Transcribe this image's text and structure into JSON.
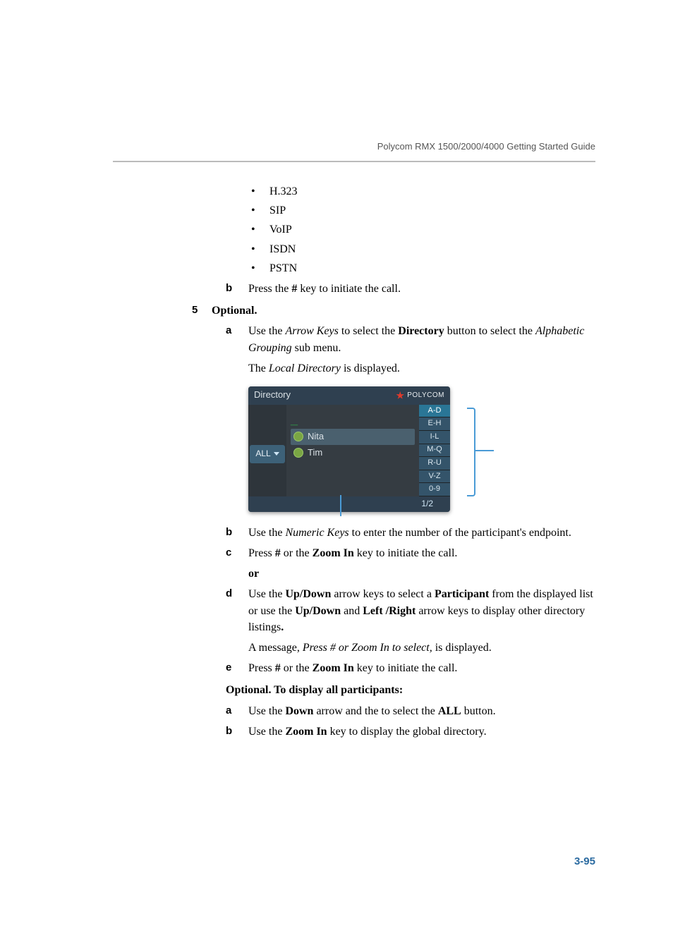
{
  "header": "Polycom RMX 1500/2000/4000 Getting Started Guide",
  "protocols": [
    "H.323",
    "SIP",
    "VoIP",
    "ISDN",
    "PSTN"
  ],
  "step_b_prefix": "Press the ",
  "step_b_bold": "#",
  "step_b_suffix": " key to initiate the call.",
  "step5_num": "5",
  "step5_label": "Optional.",
  "s5a_p1": "Use the ",
  "s5a_it1": "Arrow Keys",
  "s5a_p2": " to select the ",
  "s5a_b1": "Directory",
  "s5a_p3": " button to select the ",
  "s5a_it2": "Alphabetic Grouping",
  "s5a_p4": " sub menu.",
  "s5a_line2_p1": "The ",
  "s5a_line2_it": "Local Directory",
  "s5a_line2_p2": " is displayed.",
  "dir": {
    "title": "Directory",
    "logo": "POLYCOM",
    "all": "ALL",
    "contacts": [
      "Nita",
      "Tim"
    ],
    "ranges": [
      "A-D",
      "E-H",
      "I-L",
      "M-Q",
      "R-U",
      "V-Z",
      "0-9"
    ],
    "page": "1/2"
  },
  "s5b_p1": "Use the ",
  "s5b_it": "Numeric Keys",
  "s5b_p2": " to enter the number of the participant's endpoint.",
  "s5c_p1": "Press ",
  "s5c_b1": "#",
  "s5c_p2": " or the ",
  "s5c_b2": "Zoom In",
  "s5c_p3": " key to initiate the call.",
  "s5c_or": "or",
  "s5d_p1": "Use the ",
  "s5d_b1": "Up/Down",
  "s5d_p2": " arrow keys to select a ",
  "s5d_b2": "Participant",
  "s5d_p3": " from the displayed list or use the ",
  "s5d_b3": "Up/Down",
  "s5d_p4": " and ",
  "s5d_b4": "Left /Right",
  "s5d_p5": " arrow keys to display other directory listings",
  "s5d_b5": ".",
  "s5d_msg_p1": "A message, ",
  "s5d_msg_it": "Press # or Zoom In to select,",
  "s5d_msg_p2": " is displayed.",
  "s5e_p1": "Press ",
  "s5e_b1": "#",
  "s5e_p2": " or  the ",
  "s5e_b2": "Zoom In",
  "s5e_p3": " key to initiate the call.",
  "opt2_head": "Optional. To display all participants:",
  "opt2a_p1": "Use the ",
  "opt2a_b1": "Down",
  "opt2a_p2": " arrow and the to select the ",
  "opt2a_b2": "ALL",
  "opt2a_p3": " button.",
  "opt2b_p1": "Use the ",
  "opt2b_b1": "Zoom In",
  "opt2b_p2": " key to display the global directory.",
  "page_num": "3-95",
  "letters": {
    "a": "a",
    "b": "b",
    "c": "c",
    "d": "d",
    "e": "e"
  }
}
